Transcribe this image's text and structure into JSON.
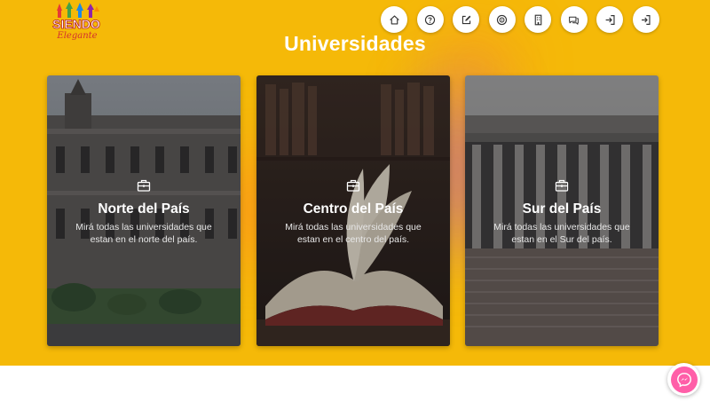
{
  "brand": {
    "logo_line1": "SIENDO",
    "logo_line2": "Elegante"
  },
  "nav": {
    "items": [
      {
        "icon": "home-icon"
      },
      {
        "icon": "help-icon"
      },
      {
        "icon": "edit-icon"
      },
      {
        "icon": "target-icon"
      },
      {
        "icon": "building-icon"
      },
      {
        "icon": "chat-icon"
      },
      {
        "icon": "login-icon"
      },
      {
        "icon": "signup-icon"
      }
    ]
  },
  "page": {
    "title": "Universidades"
  },
  "cards": [
    {
      "title": "Norte del País",
      "description": "Mirá todas las universidades que estan en el norte del país.",
      "icon": "briefcase-icon"
    },
    {
      "title": "Centro del País",
      "description": "Mirá todas las universidades que estan en el centro del país.",
      "icon": "briefcase-icon"
    },
    {
      "title": "Sur del País",
      "description": "Mirá todas las universidades que estan en el Sur del país.",
      "icon": "briefcase-icon"
    }
  ],
  "messenger": {
    "icon": "messenger-icon"
  },
  "colors": {
    "background": "#f5b908",
    "accent": "#ff5ea8",
    "text": "#ffffff"
  }
}
